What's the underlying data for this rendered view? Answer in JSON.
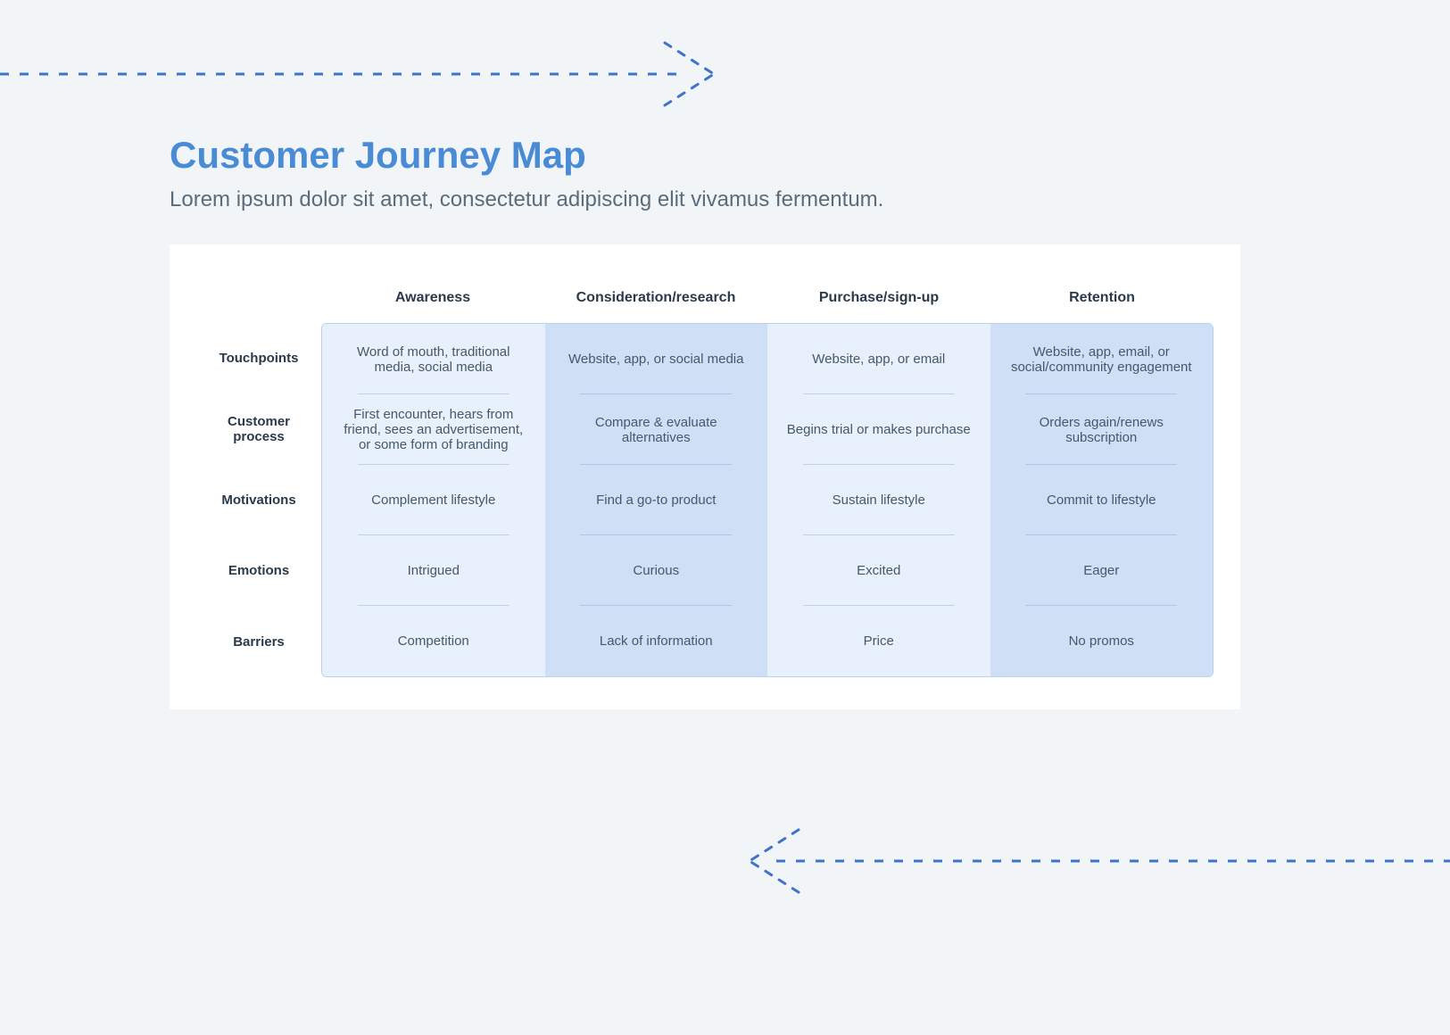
{
  "header": {
    "title": "Customer Journey Map",
    "subtitle": "Lorem ipsum dolor sit amet, consectetur adipiscing elit vivamus fermentum."
  },
  "columns": [
    "Awareness",
    "Consideration/research",
    "Purchase/sign-up",
    "Retention"
  ],
  "rows": [
    "Touchpoints",
    "Customer process",
    "Motivations",
    "Emotions",
    "Barriers"
  ],
  "cells": {
    "touchpoints": [
      "Word of mouth, traditional media, social media",
      "Website, app, or social media",
      "Website, app, or email",
      "Website, app, email, or social/community engagement"
    ],
    "customer_process": [
      "First encounter, hears from friend, sees an advertisement, or some form of branding",
      "Compare & evaluate alternatives",
      "Begins trial or makes purchase",
      "Orders again/renews subscription"
    ],
    "motivations": [
      "Complement lifestyle",
      "Find a go-to product",
      "Sustain lifestyle",
      "Commit to lifestyle"
    ],
    "emotions": [
      "Intrigued",
      "Curious",
      "Excited",
      "Eager"
    ],
    "barriers": [
      "Competition",
      "Lack of information",
      "Price",
      "No promos"
    ]
  },
  "colors": {
    "accent": "#4a8bd6",
    "light": "#e7f0fb",
    "mid": "#cfe0f6"
  }
}
